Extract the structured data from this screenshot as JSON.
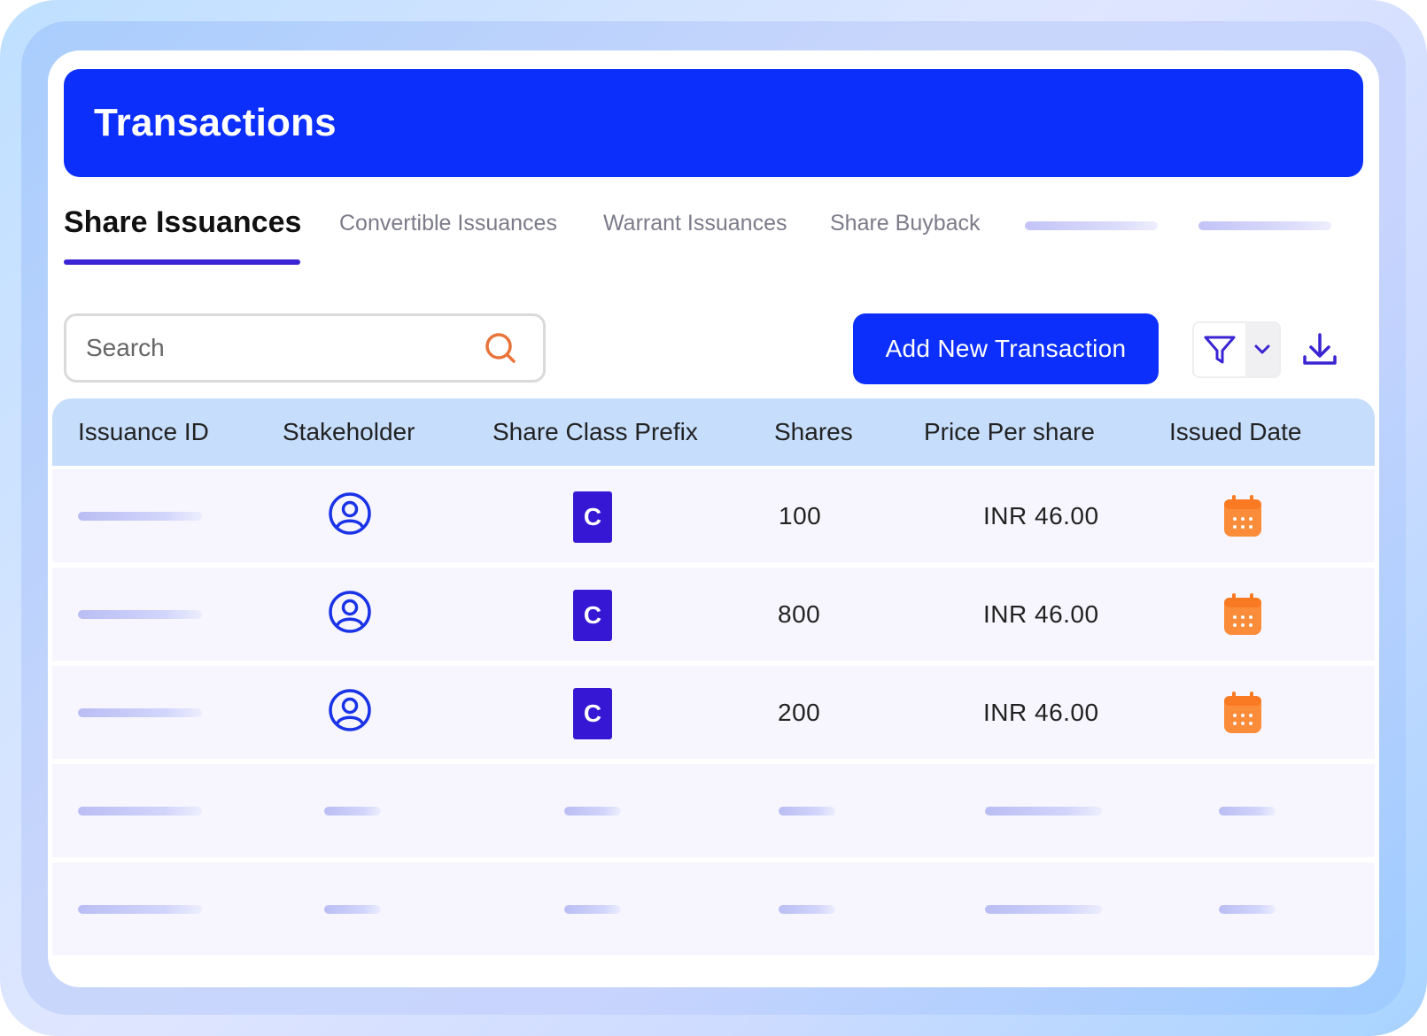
{
  "header": {
    "title": "Transactions"
  },
  "tabs": [
    {
      "label": "Share Issuances",
      "active": true
    },
    {
      "label": "Convertible Issuances",
      "active": false
    },
    {
      "label": "Warrant Issuances",
      "active": false
    },
    {
      "label": "Share Buyback",
      "active": false
    }
  ],
  "toolbar": {
    "search_placeholder": "Search",
    "add_button_label": "Add New Transaction"
  },
  "table": {
    "columns": [
      "Issuance ID",
      "Stakeholder",
      "Share Class Prefix",
      "Shares",
      "Price Per share",
      "Issued Date"
    ],
    "rows": [
      {
        "share_class": "C",
        "shares": "100",
        "price": "INR 46.00"
      },
      {
        "share_class": "C",
        "shares": "800",
        "price": "INR 46.00"
      },
      {
        "share_class": "C",
        "shares": "200",
        "price": "INR 46.00"
      }
    ]
  },
  "colors": {
    "brand_blue": "#0c2ffc",
    "accent_purple": "#3a24d3",
    "search_icon": "#e8743a",
    "calendar_icon": "#fb8c3a",
    "table_header": "#c6ddfc"
  },
  "icons": [
    "search-icon",
    "filter-icon",
    "chevron-down-icon",
    "download-icon",
    "user-avatar-icon",
    "calendar-icon"
  ]
}
